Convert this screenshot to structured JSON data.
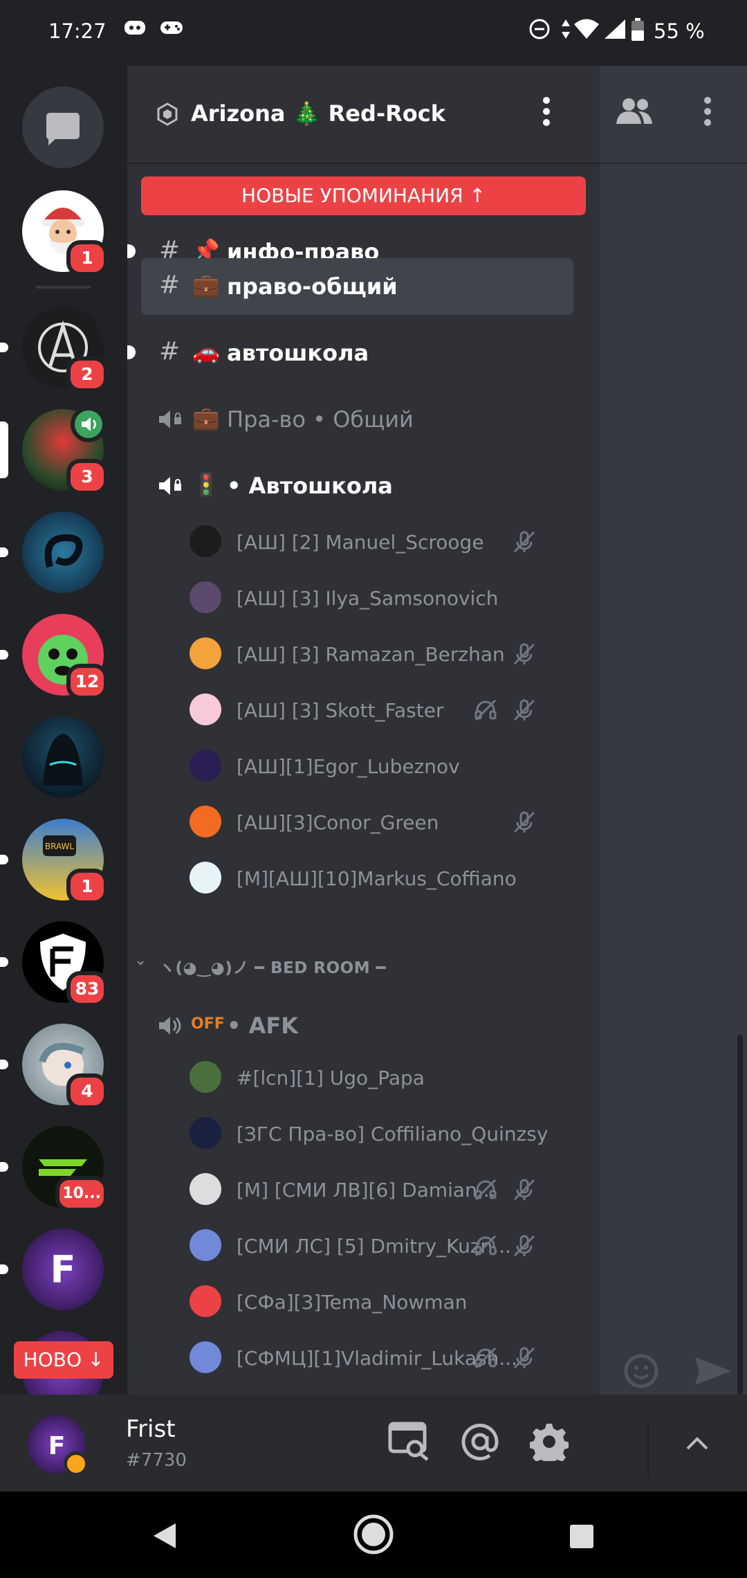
{
  "status_bar": {
    "time": "17:27",
    "battery": "55 %"
  },
  "server": {
    "name": "Arizona 🎄 Red-Rock"
  },
  "servers": [
    {
      "badge": "1",
      "color": "#ffffff"
    },
    {
      "badge": "2",
      "color": "#1b1d1f"
    },
    {
      "badge": "3",
      "color": "#6a2b2b"
    },
    {
      "badge": "",
      "color": "#1a5b7c"
    },
    {
      "badge": "12",
      "color": "#e83e5b"
    },
    {
      "badge": "",
      "color": "#0e1d2a"
    },
    {
      "badge": "1",
      "color": "#3d7ecf"
    },
    {
      "badge": "83",
      "color": "#000000"
    },
    {
      "badge": "4",
      "color": "#b7c7c9"
    },
    {
      "badge": "10...",
      "color": "#0f150c"
    },
    {
      "badge": "",
      "color": "#3b1e64"
    }
  ],
  "new_servers_label": "НОВО ↓",
  "mentions_banner": "НОВЫЕ УПОМИНАНИЯ ↑",
  "channels": [
    {
      "emoji": "📌",
      "name": "инфо-право"
    },
    {
      "emoji": "💼",
      "name": "право-общий"
    },
    {
      "emoji": "🚗",
      "name": "автошкола"
    }
  ],
  "voice_channels": [
    {
      "emoji": "💼",
      "name": "Пра-во • Общий"
    },
    {
      "emoji": "🚦",
      "name": "• Автошкола"
    }
  ],
  "voice_users_1": [
    {
      "name": "[АШ] [2] Manuel_Scrooge",
      "mute": true,
      "deaf": false,
      "color": "#1c1c1c"
    },
    {
      "name": "[АШ] [3] Ilya_Samsonovich",
      "mute": false,
      "deaf": false,
      "color": "#5b4a6b"
    },
    {
      "name": "[АШ] [3] Ramazan_Berzhan",
      "mute": true,
      "deaf": false,
      "color": "#f4a23b"
    },
    {
      "name": "[АШ] [3] Skott_Faster",
      "mute": true,
      "deaf": true,
      "color": "#f7c9d9"
    },
    {
      "name": "[АШ][1]Egor_Lubeznov",
      "mute": false,
      "deaf": false,
      "color": "#2a1e55"
    },
    {
      "name": "[АШ][3]Conor_Green",
      "mute": true,
      "deaf": false,
      "color": "#f26b21"
    },
    {
      "name": "[М][АШ][10]Markus_Coffiano",
      "mute": false,
      "deaf": false,
      "color": "#e8f3f8"
    }
  ],
  "category": "ヽ(◕‿◕)ノ ━ BED ROOM ━",
  "afk_channel": {
    "emoji": "OFF",
    "name": "• AFK"
  },
  "voice_users_2": [
    {
      "name": "#[lcn][1] Ugo_Papa",
      "mute": false,
      "deaf": false,
      "color": "#4b6f3c"
    },
    {
      "name": "[ЗГС Пра-во] Coffiliano_Quinzsy",
      "mute": false,
      "deaf": false,
      "color": "#1a2040"
    },
    {
      "name": "[М] [СМИ ЛВ][6] Damian...",
      "mute": true,
      "deaf": true,
      "color": "#dddddd"
    },
    {
      "name": "[СМИ ЛС] [5] Dmitry_Kuzn...",
      "mute": true,
      "deaf": true,
      "color": "#7289da"
    },
    {
      "name": "[СФа][3]Tema_Nowman",
      "mute": false,
      "deaf": false,
      "color": "#ed4245"
    },
    {
      "name": "[СФМЦ][1]Vladimir_Lukash...",
      "mute": true,
      "deaf": true,
      "color": "#7289da"
    }
  ],
  "user": {
    "name": "Frist",
    "tag": "#7730"
  }
}
